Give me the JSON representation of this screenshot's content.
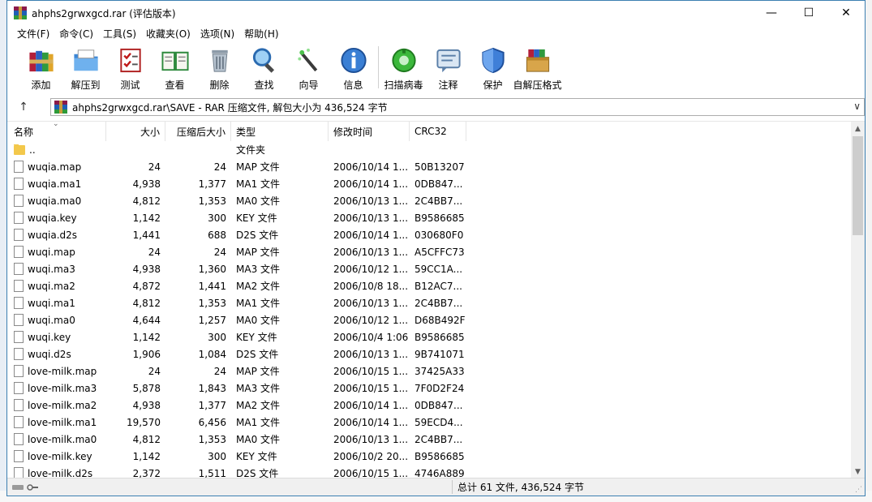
{
  "window": {
    "title": "ahphs2grwxgcd.rar (评估版本)",
    "controls": {
      "minimize": "—",
      "maximize": "☐",
      "close": "✕"
    }
  },
  "menu": [
    {
      "id": "file",
      "label": "文件(F)"
    },
    {
      "id": "command",
      "label": "命令(C)"
    },
    {
      "id": "tools",
      "label": "工具(S)"
    },
    {
      "id": "favorites",
      "label": "收藏夹(O)"
    },
    {
      "id": "options",
      "label": "选项(N)"
    },
    {
      "id": "help",
      "label": "帮助(H)"
    }
  ],
  "toolbar": [
    {
      "id": "add",
      "label": "添加",
      "icon": "books-icon"
    },
    {
      "id": "extract",
      "label": "解压到",
      "icon": "folder-icon"
    },
    {
      "id": "test",
      "label": "测试",
      "icon": "checklist-icon"
    },
    {
      "id": "view",
      "label": "查看",
      "icon": "book-icon"
    },
    {
      "id": "delete",
      "label": "删除",
      "icon": "trash-icon"
    },
    {
      "id": "find",
      "label": "查找",
      "icon": "magnifier-icon"
    },
    {
      "id": "wizard",
      "label": "向导",
      "icon": "wand-icon"
    },
    {
      "id": "info",
      "label": "信息",
      "icon": "info-icon"
    },
    {
      "id": "scan",
      "label": "扫描病毒",
      "icon": "virus-scan-icon"
    },
    {
      "id": "comment",
      "label": "注释",
      "icon": "comment-icon"
    },
    {
      "id": "protect",
      "label": "保护",
      "icon": "shield-icon"
    },
    {
      "id": "sfx",
      "label": "自解压格式",
      "icon": "sfx-box-icon"
    }
  ],
  "address": {
    "up_label": "↑",
    "path": "ahphs2grwxgcd.rar\\SAVE - RAR 压缩文件, 解包大小为 436,524 字节",
    "dropdown": "∨"
  },
  "columns": {
    "name": "名称",
    "size": "大小",
    "packed": "压缩后大小",
    "type": "类型",
    "mtime": "修改时间",
    "crc": "CRC32"
  },
  "files": [
    {
      "name": "..",
      "size": "",
      "packed": "",
      "type": "文件夹",
      "mtime": "",
      "crc": "",
      "folder": true
    },
    {
      "name": "wuqia.map",
      "size": "24",
      "packed": "24",
      "type": "MAP 文件",
      "mtime": "2006/10/14 1...",
      "crc": "50B13207"
    },
    {
      "name": "wuqia.ma1",
      "size": "4,938",
      "packed": "1,377",
      "type": "MA1 文件",
      "mtime": "2006/10/14 1...",
      "crc": "0DB847..."
    },
    {
      "name": "wuqia.ma0",
      "size": "4,812",
      "packed": "1,353",
      "type": "MA0 文件",
      "mtime": "2006/10/13 1...",
      "crc": "2C4BB7..."
    },
    {
      "name": "wuqia.key",
      "size": "1,142",
      "packed": "300",
      "type": "KEY 文件",
      "mtime": "2006/10/13 1...",
      "crc": "B9586685"
    },
    {
      "name": "wuqia.d2s",
      "size": "1,441",
      "packed": "688",
      "type": "D2S 文件",
      "mtime": "2006/10/14 1...",
      "crc": "030680F0"
    },
    {
      "name": "wuqi.map",
      "size": "24",
      "packed": "24",
      "type": "MAP 文件",
      "mtime": "2006/10/13 1...",
      "crc": "A5CFFC73"
    },
    {
      "name": "wuqi.ma3",
      "size": "4,938",
      "packed": "1,360",
      "type": "MA3 文件",
      "mtime": "2006/10/12 1...",
      "crc": "59CC1A..."
    },
    {
      "name": "wuqi.ma2",
      "size": "4,872",
      "packed": "1,441",
      "type": "MA2 文件",
      "mtime": "2006/10/8 18...",
      "crc": "B12AC7..."
    },
    {
      "name": "wuqi.ma1",
      "size": "4,812",
      "packed": "1,353",
      "type": "MA1 文件",
      "mtime": "2006/10/13 1...",
      "crc": "2C4BB7..."
    },
    {
      "name": "wuqi.ma0",
      "size": "4,644",
      "packed": "1,257",
      "type": "MA0 文件",
      "mtime": "2006/10/12 1...",
      "crc": "D68B492F"
    },
    {
      "name": "wuqi.key",
      "size": "1,142",
      "packed": "300",
      "type": "KEY 文件",
      "mtime": "2006/10/4 1:06",
      "crc": "B9586685"
    },
    {
      "name": "wuqi.d2s",
      "size": "1,906",
      "packed": "1,084",
      "type": "D2S 文件",
      "mtime": "2006/10/13 1...",
      "crc": "9B741071"
    },
    {
      "name": "love-milk.map",
      "size": "24",
      "packed": "24",
      "type": "MAP 文件",
      "mtime": "2006/10/15 1...",
      "crc": "37425A33"
    },
    {
      "name": "love-milk.ma3",
      "size": "5,878",
      "packed": "1,843",
      "type": "MA3 文件",
      "mtime": "2006/10/15 1...",
      "crc": "7F0D2F24"
    },
    {
      "name": "love-milk.ma2",
      "size": "4,938",
      "packed": "1,377",
      "type": "MA2 文件",
      "mtime": "2006/10/14 1...",
      "crc": "0DB847..."
    },
    {
      "name": "love-milk.ma1",
      "size": "19,570",
      "packed": "6,456",
      "type": "MA1 文件",
      "mtime": "2006/10/14 1...",
      "crc": "59ECD4..."
    },
    {
      "name": "love-milk.ma0",
      "size": "4,812",
      "packed": "1,353",
      "type": "MA0 文件",
      "mtime": "2006/10/13 1...",
      "crc": "2C4BB7..."
    },
    {
      "name": "love-milk.key",
      "size": "1,142",
      "packed": "300",
      "type": "KEY 文件",
      "mtime": "2006/10/2 20...",
      "crc": "B9586685"
    },
    {
      "name": "love-milk.d2s",
      "size": "2,372",
      "packed": "1,511",
      "type": "D2S 文件",
      "mtime": "2006/10/15 1...",
      "crc": "4746A889"
    }
  ],
  "status": {
    "summary": "总计 61 文件, 436,524 字节",
    "grip": "⋰"
  },
  "colors": {
    "window_border": "#3c7fb1",
    "scroll_thumb": "#cdcdcd",
    "folder": "#f3c84b"
  }
}
